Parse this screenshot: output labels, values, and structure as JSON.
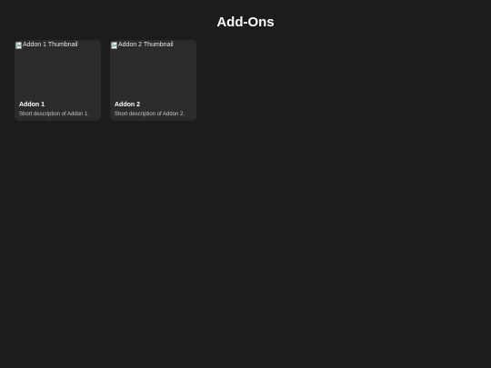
{
  "header": {
    "title": "Add-Ons"
  },
  "addons": [
    {
      "thumbnail_alt": "Addon 1 Thumbnail",
      "name": "Addon 1",
      "description": "Short description of Addon 1."
    },
    {
      "thumbnail_alt": "Addon 2 Thumbnail",
      "name": "Addon 2",
      "description": "Short description of Addon 2."
    }
  ],
  "colors": {
    "background": "#1c1c1c",
    "card": "#2b2b2b",
    "text": "#ffffff",
    "muted_text": "#c8c8c8"
  },
  "icons": {
    "thumbnail": "broken-image-icon"
  }
}
